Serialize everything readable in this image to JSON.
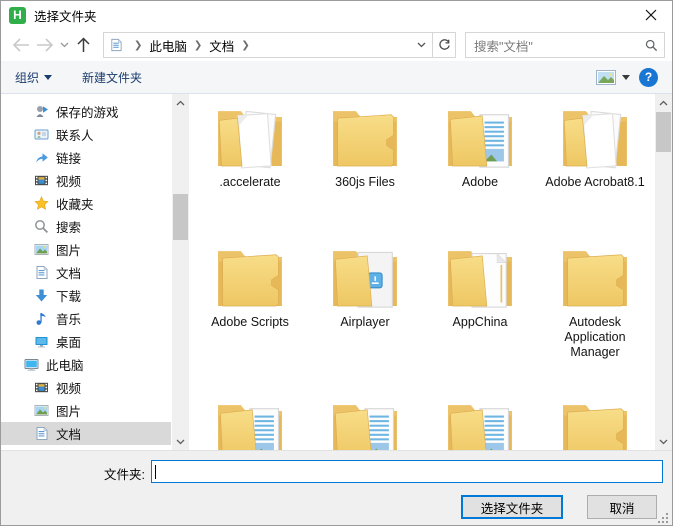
{
  "window": {
    "title": "选择文件夹",
    "app_icon_letter": "H"
  },
  "nav": {
    "breadcrumb": [
      "此电脑",
      "文档"
    ],
    "search_placeholder": "搜索\"文档\""
  },
  "toolbar": {
    "organize_label": "组织",
    "new_folder_label": "新建文件夹"
  },
  "sidebar": {
    "items": [
      {
        "label": "保存的游戏",
        "icon": "saved-games-icon",
        "level": 1,
        "selected": false
      },
      {
        "label": "联系人",
        "icon": "contacts-icon",
        "level": 1,
        "selected": false
      },
      {
        "label": "链接",
        "icon": "links-icon",
        "level": 1,
        "selected": false
      },
      {
        "label": "视频",
        "icon": "videos-icon",
        "level": 1,
        "selected": false
      },
      {
        "label": "收藏夹",
        "icon": "favorites-icon",
        "level": 1,
        "selected": false
      },
      {
        "label": "搜索",
        "icon": "search-icon",
        "level": 1,
        "selected": false
      },
      {
        "label": "图片",
        "icon": "pictures-icon",
        "level": 1,
        "selected": false
      },
      {
        "label": "文档",
        "icon": "documents-icon",
        "level": 1,
        "selected": false
      },
      {
        "label": "下载",
        "icon": "downloads-icon",
        "level": 1,
        "selected": false
      },
      {
        "label": "音乐",
        "icon": "music-icon",
        "level": 1,
        "selected": false
      },
      {
        "label": "桌面",
        "icon": "desktop-icon",
        "level": 1,
        "selected": false
      },
      {
        "label": "此电脑",
        "icon": "this-pc-icon",
        "level": 0,
        "selected": false
      },
      {
        "label": "视频",
        "icon": "videos-icon",
        "level": 1,
        "selected": false
      },
      {
        "label": "图片",
        "icon": "pictures-icon",
        "level": 1,
        "selected": false
      },
      {
        "label": "文档",
        "icon": "documents-icon",
        "level": 1,
        "selected": true
      }
    ]
  },
  "main": {
    "folders": [
      {
        "name": ".accelerate",
        "variant": "docs"
      },
      {
        "name": "360js Files",
        "variant": "plain"
      },
      {
        "name": "Adobe",
        "variant": "preview"
      },
      {
        "name": "Adobe Acrobat8.1",
        "variant": "docs"
      },
      {
        "name": "Adobe Scripts",
        "variant": "plain"
      },
      {
        "name": "Airplayer",
        "variant": "pageicon"
      },
      {
        "name": "AppChina",
        "variant": "page"
      },
      {
        "name": "Autodesk Application Manager",
        "variant": "plain"
      }
    ],
    "partial_folders": [
      {
        "variant": "preview"
      },
      {
        "variant": "preview"
      },
      {
        "variant": "preview"
      },
      {
        "variant": "plain"
      }
    ]
  },
  "footer": {
    "folder_label": "文件夹:",
    "input_value": "",
    "select_button": "选择文件夹",
    "cancel_button": "取消"
  },
  "colors": {
    "accent": "#0078d7",
    "folder_front": "#f3d67b",
    "folder_back": "#e7b858",
    "help_blue": "#1976d2",
    "selected_bg": "#d9d9d9"
  }
}
